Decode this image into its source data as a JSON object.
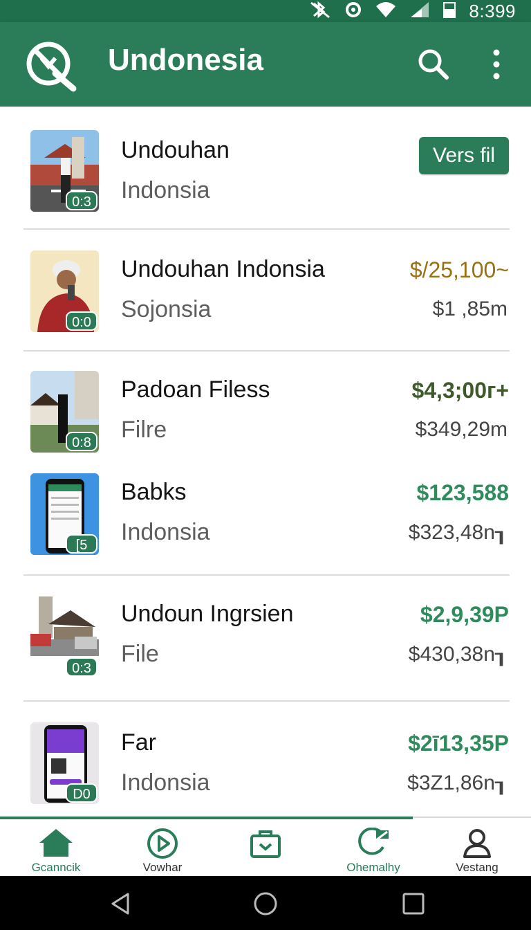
{
  "status_bar": {
    "time": "8:399",
    "icons": [
      "bluetooth-off-icon",
      "sync-icon",
      "wifi-icon",
      "signal-icon",
      "battery-icon"
    ]
  },
  "app_bar": {
    "title": "Undonesia",
    "logo_icon": "no-download-icon",
    "search_icon": "search-icon",
    "more_icon": "more-vert-icon"
  },
  "colors": {
    "primary": "#2b7d5a",
    "status_bar": "#1f6e4c",
    "price_gold": "#9a7010",
    "price_dark_green": "#3f5a2a",
    "price_green": "#2f8a5c"
  },
  "items": [
    {
      "title": "Undouhan",
      "subtitle": "Indonsia",
      "duration": "0:3",
      "button": "Vers fil",
      "thumb": "street-photo"
    },
    {
      "title": "Undouhan Indonsia",
      "subtitle": "Sojonsia",
      "duration": "0:0",
      "price": "$/25,100~",
      "price_sub": "$1 ,85m",
      "thumb": "person-photo"
    },
    {
      "title": "Padoan Filess",
      "subtitle": "Filre",
      "duration": "0:8",
      "price": "$4,3;00г+",
      "price_sub": "$349,29m",
      "thumb": "street-photo"
    },
    {
      "title": "Babks",
      "subtitle": "Indonsia",
      "duration": "[5",
      "price": "$123,588",
      "price_sub": "$323,48n┒",
      "thumb": "phone-screenshot"
    },
    {
      "title": "Undoun Ingrsien",
      "subtitle": "File",
      "duration": "0:3",
      "price": "$2,9,39P",
      "price_sub": "$430,38n┒",
      "thumb": "house-photo"
    },
    {
      "title": "Far",
      "subtitle": "Indonsia",
      "duration": "D0",
      "price": "$2ī13,35P",
      "price_sub": "$3Z1,86n┒",
      "thumb": "phone-purple"
    }
  ],
  "bottom_nav": {
    "progress": 0.777,
    "items": [
      {
        "label": "Gcanncik",
        "icon": "home-icon",
        "active": true
      },
      {
        "label": "Vowhar",
        "icon": "play-circle-icon",
        "active": false
      },
      {
        "label": "",
        "icon": "download-box-icon",
        "active": false
      },
      {
        "label": "Ohemalhy",
        "icon": "message-edit-icon",
        "active": true
      },
      {
        "label": "Vestang",
        "icon": "person-icon",
        "active": false
      }
    ]
  },
  "system_nav": [
    "back-icon",
    "home-circle-icon",
    "recents-icon"
  ]
}
